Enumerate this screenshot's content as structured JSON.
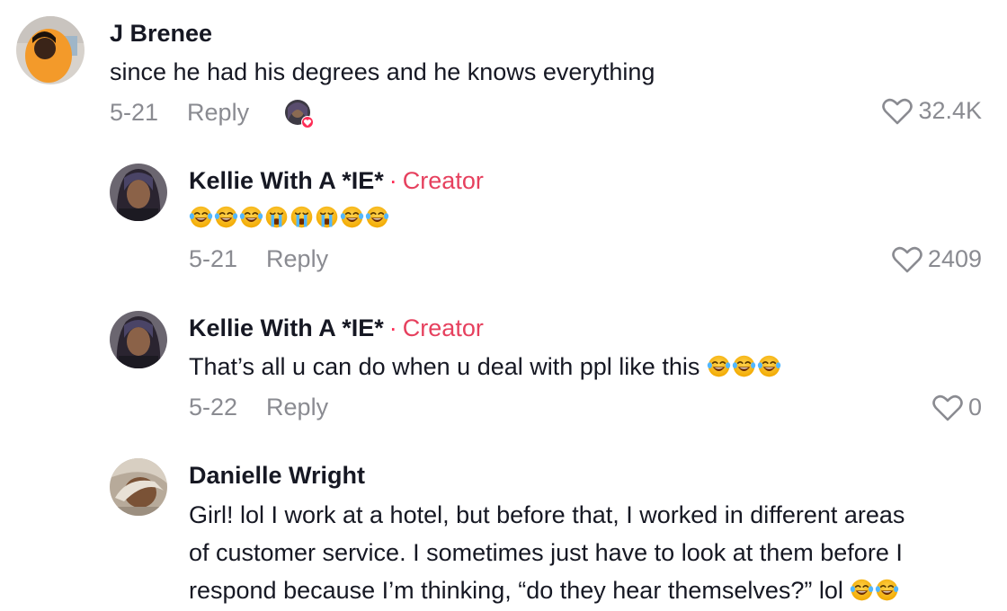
{
  "comments": [
    {
      "author": "J Brenee",
      "text": "since he had his degrees and he knows everything",
      "date": "5-21",
      "reply_label": "Reply",
      "likes": "32.4K"
    },
    {
      "author": "Kellie With A *IE*",
      "separator": "·",
      "badge": "Creator",
      "emojis": [
        "laughing-tears",
        "laughing-tears",
        "laughing-tears",
        "crying",
        "crying",
        "crying",
        "laughing-tears",
        "laughing-tears"
      ],
      "date": "5-21",
      "reply_label": "Reply",
      "likes": "2409"
    },
    {
      "author": "Kellie With A *IE*",
      "separator": "·",
      "badge": "Creator",
      "text": "That’s all u can do when u deal with ppl like this",
      "date": "5-22",
      "reply_label": "Reply",
      "likes": "0"
    },
    {
      "author": "Danielle Wright",
      "lines": [
        "Girl! lol I work at a hotel, but before that, I worked in different areas",
        "of customer service. I sometimes just have to look at them before I",
        "respond because I’m thinking, “do they hear themselves?” lol"
      ]
    }
  ],
  "colors": {
    "text": "#161823",
    "meta": "#8a8b91",
    "creator_badge": "#e6405e",
    "liked_heart": "#fe2c55"
  }
}
